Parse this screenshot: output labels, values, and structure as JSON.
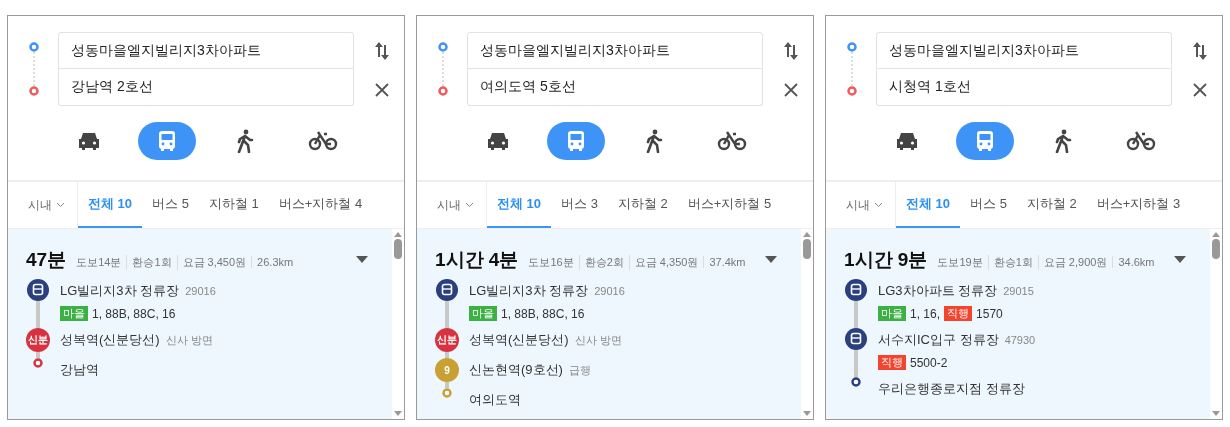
{
  "panels": [
    {
      "origin": "성동마을엘지빌리지3차아파트",
      "destination": "강남역 2호선",
      "modes": [
        {
          "kind": "car",
          "selected": false
        },
        {
          "kind": "bus",
          "selected": true
        },
        {
          "kind": "walk",
          "selected": false
        },
        {
          "kind": "bike",
          "selected": false
        }
      ],
      "region": "시내",
      "tabs": [
        {
          "label": "전체 10",
          "selected": true
        },
        {
          "label": "버스 5",
          "selected": false
        },
        {
          "label": "지하철 1",
          "selected": false
        },
        {
          "label": "버스+지하철 4",
          "selected": false
        }
      ],
      "route": {
        "duration": "47분",
        "details": [
          "도보14분",
          "환승1회",
          "요금 3,450원",
          "26.3km"
        ],
        "steps": [
          {
            "kind": "bus",
            "color": "#2a3f7e",
            "name": "LG빌리지3차 정류장",
            "note": "29016",
            "lines": [
              {
                "badge": "마을",
                "color": "#3cb043",
                "numbers": "1, 88B, 88C, 16"
              }
            ]
          },
          {
            "kind": "line",
            "color": "#d6323f",
            "marker": "신분",
            "name": "성복역(신분당선)",
            "note": "신사 방면"
          },
          {
            "kind": "end",
            "color": "#d6323f",
            "name": "강남역"
          }
        ]
      }
    },
    {
      "origin": "성동마을엘지빌리지3차아파트",
      "destination": "여의도역 5호선",
      "modes": [
        {
          "kind": "car",
          "selected": false
        },
        {
          "kind": "bus",
          "selected": true
        },
        {
          "kind": "walk",
          "selected": false
        },
        {
          "kind": "bike",
          "selected": false
        }
      ],
      "region": "시내",
      "tabs": [
        {
          "label": "전체 10",
          "selected": true
        },
        {
          "label": "버스 3",
          "selected": false
        },
        {
          "label": "지하철 2",
          "selected": false
        },
        {
          "label": "버스+지하철 5",
          "selected": false
        }
      ],
      "route": {
        "duration": "1시간 4분",
        "details": [
          "도보16분",
          "환승2회",
          "요금 4,350원",
          "37.4km"
        ],
        "steps": [
          {
            "kind": "bus",
            "color": "#2a3f7e",
            "name": "LG빌리지3차 정류장",
            "note": "29016",
            "lines": [
              {
                "badge": "마을",
                "color": "#3cb043",
                "numbers": "1, 88B, 88C, 16"
              }
            ]
          },
          {
            "kind": "line",
            "color": "#d6323f",
            "marker": "신분",
            "name": "성복역(신분당선)",
            "note": "신사 방면"
          },
          {
            "kind": "line",
            "color": "#c9a033",
            "marker": "9",
            "name": "신논현역(9호선)",
            "note": "급행"
          },
          {
            "kind": "end",
            "color": "#c9a033",
            "name": "여의도역"
          }
        ]
      }
    },
    {
      "origin": "성동마을엘지빌리지3차아파트",
      "destination": "시청역 1호선",
      "modes": [
        {
          "kind": "car",
          "selected": false
        },
        {
          "kind": "bus",
          "selected": true
        },
        {
          "kind": "walk",
          "selected": false
        },
        {
          "kind": "bike",
          "selected": false
        }
      ],
      "region": "시내",
      "tabs": [
        {
          "label": "전체 10",
          "selected": true
        },
        {
          "label": "버스 5",
          "selected": false
        },
        {
          "label": "지하철 2",
          "selected": false
        },
        {
          "label": "버스+지하철 3",
          "selected": false
        }
      ],
      "route": {
        "duration": "1시간 9분",
        "details": [
          "도보19분",
          "환승1회",
          "요금 2,900원",
          "34.6km"
        ],
        "steps": [
          {
            "kind": "bus",
            "color": "#2a3f7e",
            "name": "LG3차아파트 정류장",
            "note": "29015",
            "lines": [
              {
                "badge": "마을",
                "color": "#3cb043",
                "numbers": "1, 16,"
              },
              {
                "badge": "직행",
                "color": "#f2452e",
                "numbers": "1570"
              }
            ]
          },
          {
            "kind": "bus",
            "color": "#2a3f7e",
            "name": "서수지IC입구 정류장",
            "note": "47930",
            "lines": [
              {
                "badge": "직행",
                "color": "#f2452e",
                "numbers": "5500-2"
              }
            ]
          },
          {
            "kind": "end",
            "color": "#2a3f7e",
            "name": "우리은행종로지점 정류장"
          }
        ]
      }
    }
  ]
}
